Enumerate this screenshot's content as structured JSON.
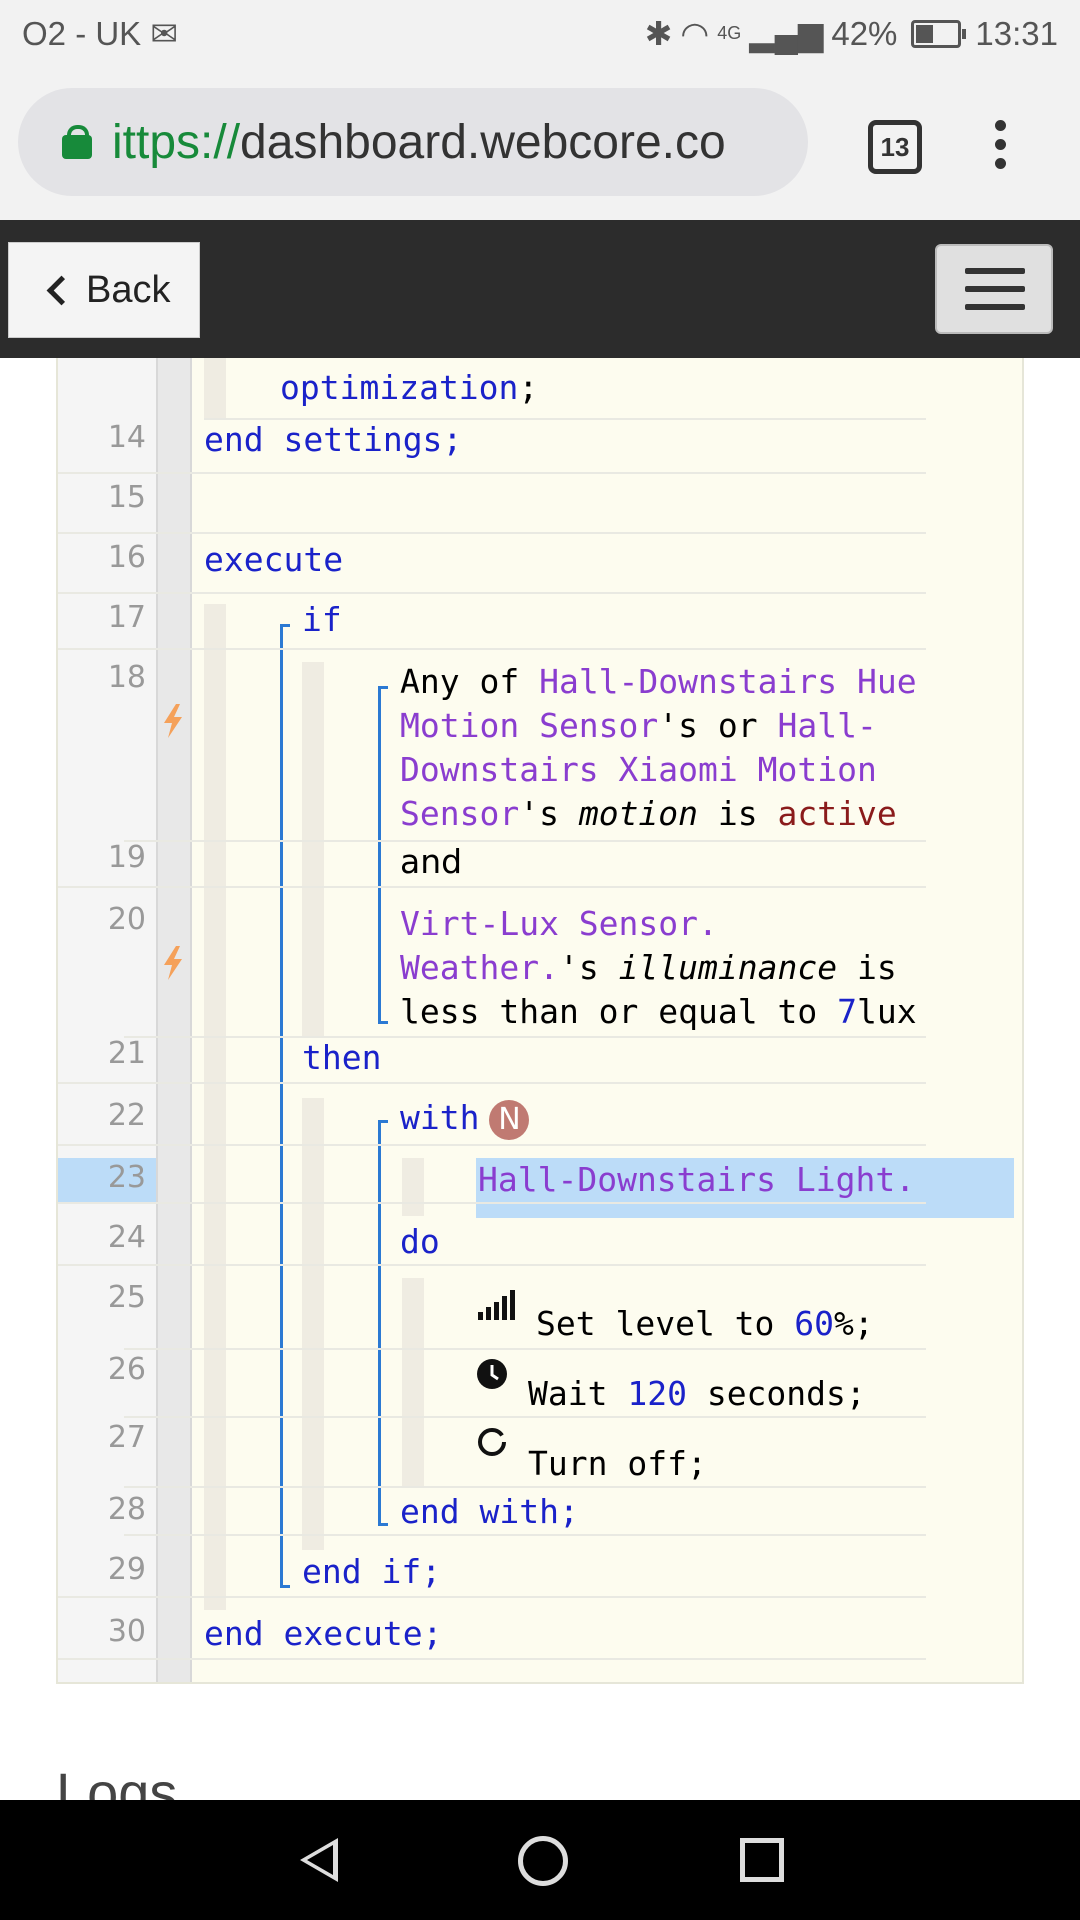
{
  "status_bar": {
    "carrier": "O2 - UK",
    "signal_label": "4G",
    "battery_level": 0.42,
    "battery": "42%",
    "time": "13:31"
  },
  "browser": {
    "url_scheme": "ittps://",
    "url_host": "dashboard.webcore.co",
    "tab_count": "13"
  },
  "navbar": {
    "back_label": "Back"
  },
  "code": {
    "line_numbers": [
      "14",
      "15",
      "16",
      "17",
      "18",
      "19",
      "20",
      "21",
      "22",
      "23",
      "24",
      "25",
      "26",
      "27",
      "28",
      "29",
      "30"
    ],
    "l13_optimization": "optimization",
    "semicolon": ";",
    "l14_end": "end",
    "l14_settings": "settings",
    "l16_execute": "execute",
    "l17_if": "if",
    "l18_anyof": "Any of ",
    "l18_dev1a": "Hall-Downstairs Hue",
    "l18_dev1b": "Motion Sensor",
    "l18_s_or": "'s or ",
    "l18_dev2a": "Hall-",
    "l18_dev2b": "Downstairs Xiaomi Motion",
    "l18_dev2c": "Sensor",
    "l18_s": "'s ",
    "l18_attr": "motion",
    "l18_is": " is ",
    "l18_val": "active",
    "l19_and": "and",
    "l20_dev1": "Virt-Lux Sensor.",
    "l20_dev2": "Weather.",
    "l20_s": "'s ",
    "l20_attr": "illuminance",
    "l20_is": " is",
    "l20_cmp": "less than or equal to ",
    "l20_num": "7",
    "l20_unit": "lux",
    "l21_then": "then",
    "l22_with": "with",
    "l22_badge": "N",
    "l23_device": "Hall-Downstairs Light.",
    "l24_do": "do",
    "l25_text": "Set level to ",
    "l25_num": "60",
    "l25_tail": "%;",
    "l26_text": "Wait ",
    "l26_num": "120",
    "l26_tail": " seconds;",
    "l27_text": "Turn off;",
    "l28_end": "end",
    "l28_with": "with;",
    "l29_end": "end",
    "l29_if": "if;",
    "l30_end": "end",
    "l30_execute": "execute;"
  },
  "section": {
    "logs_title": "Logs"
  },
  "icons": {
    "lock": "lock-icon",
    "bolt": "bolt-icon",
    "level": "signal-bars-icon",
    "wait": "clock-icon",
    "off": "power-ring-icon"
  }
}
